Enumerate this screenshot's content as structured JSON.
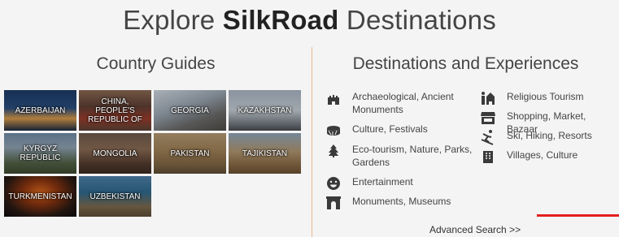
{
  "header": {
    "title_pre": "Explore ",
    "title_bold": "SilkRoad",
    "title_post": " Destinations"
  },
  "country_guides": {
    "heading": "Country Guides",
    "countries": [
      {
        "label": "AZERBAIJAN"
      },
      {
        "label": "CHINA, PEOPLE'S REPUBLIC OF"
      },
      {
        "label": "GEORGIA"
      },
      {
        "label": "KAZAKHSTAN"
      },
      {
        "label": "KYRGYZ REPUBLIC"
      },
      {
        "label": "MONGOLIA"
      },
      {
        "label": "PAKISTAN"
      },
      {
        "label": "TAJIKISTAN"
      },
      {
        "label": "TURKMENISTAN"
      },
      {
        "label": "UZBEKISTAN"
      }
    ]
  },
  "destinations": {
    "heading": "Destinations and Experiences",
    "left": [
      {
        "label": "Archaeological, Ancient Monuments",
        "icon": "castle-icon"
      },
      {
        "label": "Culture, Festivals",
        "icon": "drum-icon"
      },
      {
        "label": "Eco-tourism, Nature, Parks, Gardens",
        "icon": "tree-icon"
      },
      {
        "label": "Entertainment",
        "icon": "smile-icon"
      },
      {
        "label": "Monuments, Museums",
        "icon": "arch-icon"
      }
    ],
    "right": [
      {
        "label": "Religious Tourism",
        "icon": "temple-icon"
      },
      {
        "label": "Shopping, Market, Bazaar",
        "icon": "store-icon"
      },
      {
        "label": "Ski, Hiking, Resorts",
        "icon": "skier-icon"
      },
      {
        "label": "Villages, Culture",
        "icon": "village-icon"
      }
    ],
    "advanced_search": "Advanced Search >>"
  },
  "colors": {
    "divider": "#e6b98a",
    "accent_line": "#e31e1e",
    "icon": "#3a3a3a"
  }
}
